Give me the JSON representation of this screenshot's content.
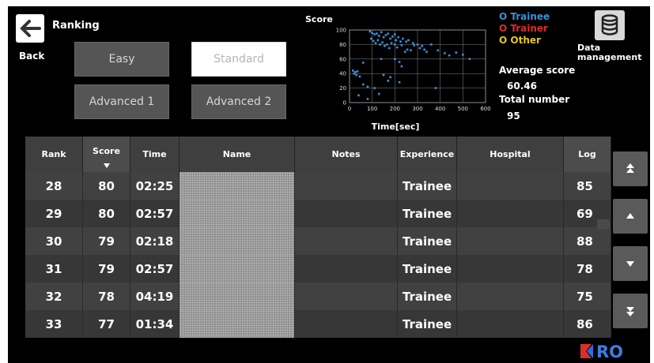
{
  "header": {
    "title": "Ranking",
    "back_label": "Back",
    "data_management_label": "Data management"
  },
  "difficulty": {
    "buttons": [
      "Easy",
      "Standard",
      "Advanced 1",
      "Advanced 2"
    ],
    "selected": "Standard"
  },
  "chart_data": {
    "type": "scatter",
    "title": "Score",
    "xlabel": "Time[sec]",
    "ylabel": "",
    "xlim": [
      0,
      600
    ],
    "ylim": [
      0,
      100
    ],
    "xticks": [
      0,
      100,
      200,
      300,
      400,
      500,
      600
    ],
    "yticks": [
      0,
      20,
      40,
      60,
      80,
      100
    ],
    "grid": true,
    "series": [
      {
        "name": "Trainee",
        "color": "#3a8fd6",
        "points": [
          [
            90,
            98
          ],
          [
            100,
            96
          ],
          [
            110,
            94
          ],
          [
            120,
            95
          ],
          [
            130,
            92
          ],
          [
            140,
            97
          ],
          [
            150,
            90
          ],
          [
            160,
            93
          ],
          [
            170,
            95
          ],
          [
            180,
            88
          ],
          [
            190,
            91
          ],
          [
            200,
            94
          ],
          [
            205,
            86
          ],
          [
            215,
            90
          ],
          [
            225,
            84
          ],
          [
            235,
            88
          ],
          [
            250,
            84
          ],
          [
            260,
            86
          ],
          [
            280,
            82
          ],
          [
            300,
            80
          ],
          [
            95,
            88
          ],
          [
            105,
            85
          ],
          [
            115,
            82
          ],
          [
            125,
            86
          ],
          [
            135,
            80
          ],
          [
            145,
            83
          ],
          [
            155,
            78
          ],
          [
            165,
            80
          ],
          [
            175,
            75
          ],
          [
            185,
            82
          ],
          [
            200,
            80
          ],
          [
            210,
            76
          ],
          [
            230,
            79
          ],
          [
            245,
            70
          ],
          [
            255,
            73
          ],
          [
            270,
            72
          ],
          [
            285,
            79
          ],
          [
            310,
            75
          ],
          [
            320,
            78
          ],
          [
            330,
            73
          ],
          [
            340,
            70
          ],
          [
            360,
            80
          ],
          [
            390,
            72
          ],
          [
            420,
            68
          ],
          [
            440,
            65
          ],
          [
            470,
            69
          ],
          [
            500,
            66
          ],
          [
            530,
            60
          ],
          [
            200,
            60
          ],
          [
            220,
            56
          ],
          [
            230,
            50
          ],
          [
            20,
            40
          ],
          [
            25,
            42
          ],
          [
            30,
            38
          ],
          [
            35,
            43
          ],
          [
            15,
            44
          ],
          [
            45,
            36
          ],
          [
            60,
            25
          ],
          [
            80,
            22
          ],
          [
            110,
            20
          ],
          [
            130,
            12
          ],
          [
            150,
            38
          ],
          [
            180,
            35
          ],
          [
            60,
            55
          ],
          [
            40,
            10
          ],
          [
            80,
            5
          ],
          [
            170,
            30
          ],
          [
            380,
            20
          ],
          [
            220,
            28
          ],
          [
            140,
            60
          ]
        ]
      },
      {
        "name": "Trainer",
        "color": "#e02b2b",
        "points": []
      },
      {
        "name": "Other",
        "color": "#e6c619",
        "points": []
      }
    ]
  },
  "legend": {
    "trainee": "O Trainee",
    "trainer": "O Trainer",
    "other": "O Other"
  },
  "stats": {
    "avg_label": "Average score",
    "avg_value": "60.46",
    "total_label": "Total number",
    "total_value": "95"
  },
  "table": {
    "columns": [
      "Rank",
      "Score",
      "Time",
      "Name",
      "Notes",
      "Experience",
      "Hospital",
      "Log"
    ],
    "sorted_by": "Score",
    "rows": [
      {
        "rank": "28",
        "score": "80",
        "time": "02:25",
        "name": "",
        "notes": "",
        "experience": "Trainee",
        "hospital": "",
        "log": "85"
      },
      {
        "rank": "29",
        "score": "80",
        "time": "02:57",
        "name": "",
        "notes": "",
        "experience": "Trainee",
        "hospital": "",
        "log": "69"
      },
      {
        "rank": "30",
        "score": "79",
        "time": "02:18",
        "name": "",
        "notes": "",
        "experience": "Trainee",
        "hospital": "",
        "log": "88"
      },
      {
        "rank": "31",
        "score": "79",
        "time": "02:57",
        "name": "",
        "notes": "",
        "experience": "Trainee",
        "hospital": "",
        "log": "78"
      },
      {
        "rank": "32",
        "score": "78",
        "time": "04:19",
        "name": "",
        "notes": "",
        "experience": "Trainee",
        "hospital": "",
        "log": "75"
      },
      {
        "rank": "33",
        "score": "77",
        "time": "01:34",
        "name": "",
        "notes": "",
        "experience": "Trainee",
        "hospital": "",
        "log": "86"
      }
    ]
  },
  "scroll": [
    "top",
    "up",
    "down",
    "bottom"
  ],
  "logo": {
    "text": "RO"
  }
}
